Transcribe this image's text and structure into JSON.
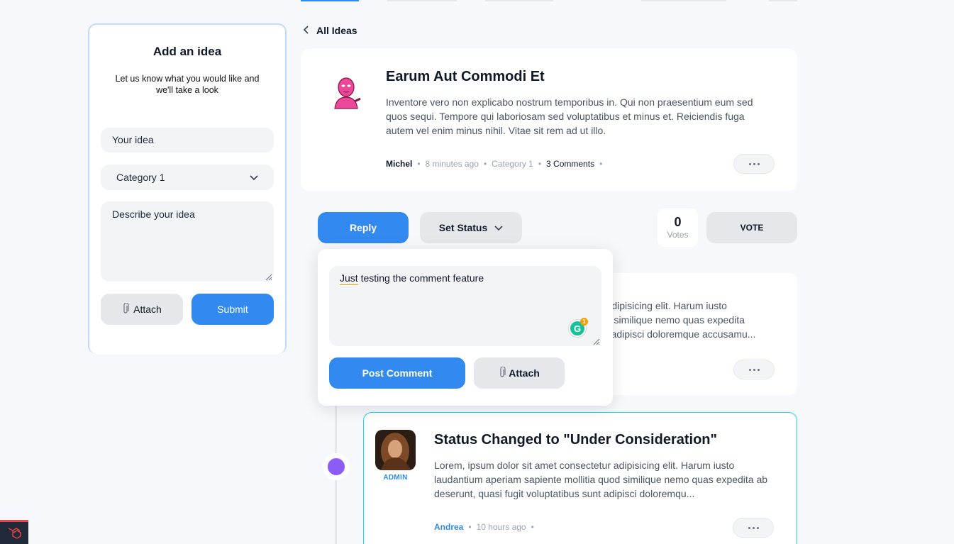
{
  "colors": {
    "accent": "#328af1",
    "status_purple": "#8b5cf6"
  },
  "sidebar": {
    "title": "Add an idea",
    "subtitle": "Let us know what you would like and we'll take a look",
    "idea_placeholder": "Your idea",
    "category_value": "Category 1",
    "description_placeholder": "Describe your idea",
    "attach_label": "Attach",
    "submit_label": "Submit"
  },
  "nav": {
    "back_label": "All Ideas"
  },
  "idea": {
    "title": "Earum Aut Commodi Et",
    "description": "Inventore vero non explicabo nostrum temporibus in. Qui non praesentium eum sed quos sequi. Tempore qui laboriosam sed voluptatibus et minus et. Reiciendis fuga autem vel enim minus nihil. Vitae sit rem ad ut illo.",
    "author": "Michel",
    "time": "8 minutes ago",
    "category": "Category 1",
    "comments": "3 Comments"
  },
  "actions": {
    "reply_label": "Reply",
    "set_status_label": "Set Status",
    "votes_count": "0",
    "votes_label": "Votes",
    "vote_label": "VOTE"
  },
  "reply_popup": {
    "comment_first_word": "Just",
    "comment_rest": " testing the comment feature",
    "post_label": "Post Comment",
    "attach_label": "Attach",
    "grammarly_count": "1"
  },
  "hidden_comment": {
    "line1": "r adipisicing elit. Harum iusto",
    "line2": "od similique nemo quas expedita",
    "line3": "nt adipisci doloremque accusamu..."
  },
  "status_comment": {
    "title": "Status Changed to \"Under Consideration\"",
    "role": "ADMIN",
    "description": "Lorem, ipsum dolor sit amet consectetur adipisicing elit. Harum iusto laudantium aperiam sapiente mollitia quod similique nemo quas expedita ab deserunt, quasi fugit voluptatibus sunt adipisci doloremqu...",
    "author": "Andrea",
    "time": "10 hours ago"
  }
}
